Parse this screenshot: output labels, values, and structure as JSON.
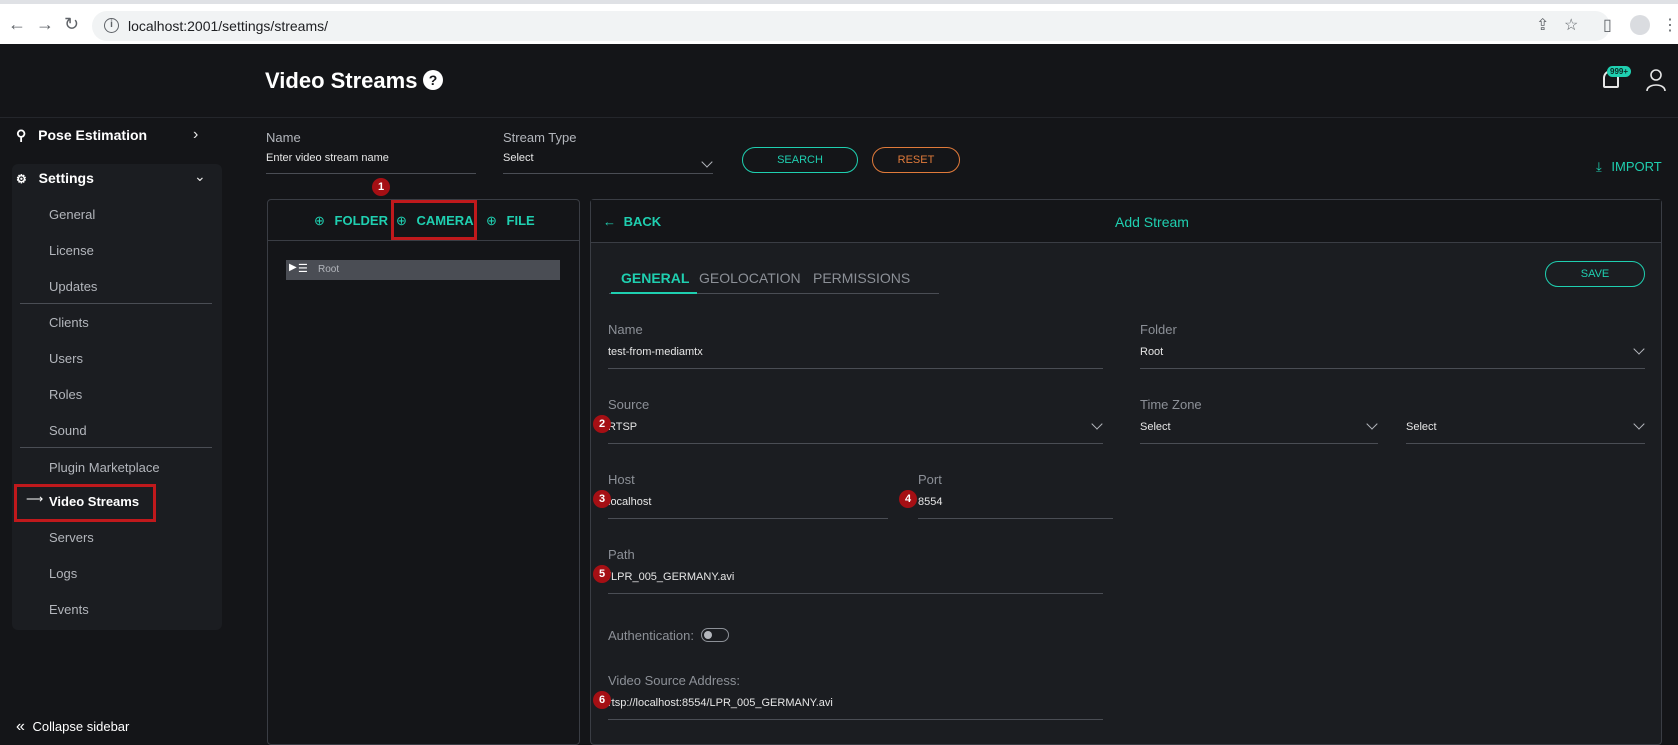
{
  "browser": {
    "url": "localhost:2001/settings/streams/"
  },
  "header": {
    "title": "Video Streams",
    "help": "?",
    "notif_badge": "999+"
  },
  "sidebar": {
    "pose_estimation": "Pose Estimation",
    "settings": "Settings",
    "items": [
      {
        "label": "General"
      },
      {
        "label": "License"
      },
      {
        "label": "Updates"
      },
      {
        "label": "Clients"
      },
      {
        "label": "Users"
      },
      {
        "label": "Roles"
      },
      {
        "label": "Sound"
      },
      {
        "label": "Plugin Marketplace"
      },
      {
        "label": "Video Streams"
      },
      {
        "label": "Servers"
      },
      {
        "label": "Logs"
      },
      {
        "label": "Events"
      }
    ],
    "collapse": "Collapse sidebar"
  },
  "filters": {
    "name_label": "Name",
    "name_placeholder": "Enter video stream name",
    "type_label": "Stream Type",
    "type_value": "Select",
    "search": "SEARCH",
    "reset": "RESET",
    "import": "IMPORT"
  },
  "tree": {
    "folder": "FOLDER",
    "camera": "CAMERA",
    "file": "FILE",
    "root": "Root"
  },
  "form": {
    "back": "BACK",
    "title": "Add Stream",
    "tabs": [
      "GENERAL",
      "GEOLOCATION",
      "PERMISSIONS"
    ],
    "save": "SAVE",
    "name_label": "Name",
    "name_value": "test-from-mediamtx",
    "folder_label": "Folder",
    "folder_value": "Root",
    "source_label": "Source",
    "source_value": "RTSP",
    "tz_label": "Time Zone",
    "tz_value1": "Select",
    "tz_value2": "Select",
    "host_label": "Host",
    "host_value": "localhost",
    "port_label": "Port",
    "port_value": "8554",
    "path_label": "Path",
    "path_value": "/LPR_005_GERMANY.avi",
    "auth_label": "Authentication:",
    "vsa_label": "Video Source Address:",
    "vsa_value": "rtsp://localhost:8554/LPR_005_GERMANY.avi"
  },
  "markers": [
    "1",
    "2",
    "3",
    "4",
    "5",
    "6"
  ]
}
